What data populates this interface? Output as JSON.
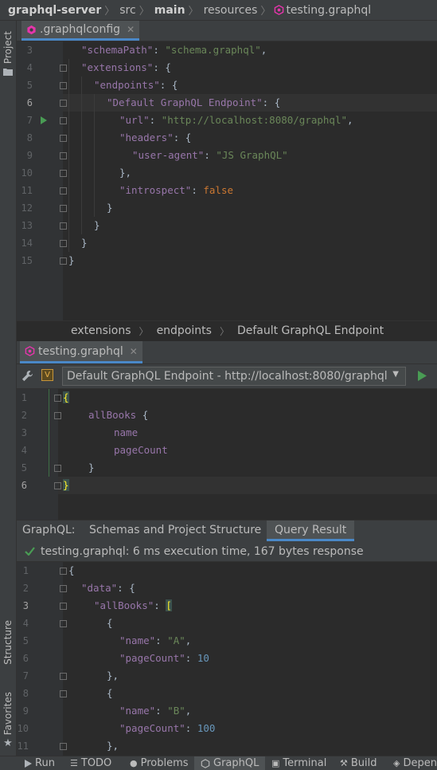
{
  "breadcrumb": {
    "items": [
      "graphql-server",
      "src",
      "main",
      "resources",
      "testing.graphql"
    ]
  },
  "left_strip": {
    "project": "Project",
    "structure": "Structure",
    "favorites": "Favorites"
  },
  "config_tab": {
    "label": ".graphqlconfig",
    "close": "✕"
  },
  "config_editor": {
    "lines": [
      {
        "num": "3",
        "parts": [
          [
            "k",
            "\"schemaPath\""
          ],
          [
            "p",
            ": "
          ],
          [
            "s",
            "\"schema.graphql\""
          ],
          [
            "p",
            ","
          ]
        ]
      },
      {
        "num": "4",
        "parts": [
          [
            "k",
            "\"extensions\""
          ],
          [
            "p",
            ": {"
          ]
        ]
      },
      {
        "num": "5",
        "parts": [
          [
            "k",
            "\"endpoints\""
          ],
          [
            "p",
            ": {"
          ]
        ]
      },
      {
        "num": "6",
        "parts": [
          [
            "k",
            "\"Default GraphQL Endpoint\""
          ],
          [
            "p",
            ": {"
          ]
        ]
      },
      {
        "num": "7",
        "parts": [
          [
            "k",
            "\"url\""
          ],
          [
            "p",
            ": "
          ],
          [
            "s",
            "\"http://localhost:8080/graphql\""
          ],
          [
            "p",
            ","
          ]
        ]
      },
      {
        "num": "8",
        "parts": [
          [
            "k",
            "\"headers\""
          ],
          [
            "p",
            ": {"
          ]
        ]
      },
      {
        "num": "9",
        "parts": [
          [
            "k",
            "\"user-agent\""
          ],
          [
            "p",
            ": "
          ],
          [
            "s",
            "\"JS GraphQL\""
          ]
        ]
      },
      {
        "num": "10",
        "parts": [
          [
            "p",
            "},"
          ]
        ]
      },
      {
        "num": "11",
        "parts": [
          [
            "k",
            "\"introspect\""
          ],
          [
            "p",
            ": "
          ],
          [
            "kw",
            "false"
          ]
        ]
      },
      {
        "num": "12",
        "parts": [
          [
            "p",
            "}"
          ]
        ]
      },
      {
        "num": "13",
        "parts": [
          [
            "p",
            "}"
          ]
        ]
      },
      {
        "num": "14",
        "parts": [
          [
            "p",
            "}"
          ]
        ]
      },
      {
        "num": "15",
        "parts": [
          [
            "p",
            "}"
          ]
        ]
      }
    ]
  },
  "config_breadcrumb": [
    "extensions",
    "endpoints",
    "Default GraphQL Endpoint"
  ],
  "query_tab": {
    "label": "testing.graphql",
    "close": "✕"
  },
  "endpoint": {
    "badge": "V",
    "selected": "Default GraphQL Endpoint - http://localhost:8080/graphql"
  },
  "query_editor": {
    "lines": [
      {
        "num": "1",
        "parts": [
          [
            "p",
            "{"
          ]
        ]
      },
      {
        "num": "2",
        "parts": [
          [
            "k",
            "allBooks"
          ],
          [
            "p",
            " {"
          ]
        ]
      },
      {
        "num": "3",
        "parts": [
          [
            "k",
            "name"
          ]
        ]
      },
      {
        "num": "4",
        "parts": [
          [
            "k",
            "pageCount"
          ]
        ]
      },
      {
        "num": "5",
        "parts": [
          [
            "p",
            "}"
          ]
        ]
      },
      {
        "num": "6",
        "parts": [
          [
            "p",
            "}"
          ]
        ]
      }
    ]
  },
  "result_tabs": {
    "prefix": "GraphQL:",
    "tab1": "Schemas and Project Structure",
    "tab2": "Query Result"
  },
  "status": {
    "text": "testing.graphql: 6 ms execution time, 167 bytes response"
  },
  "result_editor": {
    "lines": [
      {
        "num": "1",
        "parts": [
          [
            "p",
            "{"
          ]
        ]
      },
      {
        "num": "2",
        "parts": [
          [
            "k",
            "\"data\""
          ],
          [
            "p",
            ": {"
          ]
        ]
      },
      {
        "num": "3",
        "parts": [
          [
            "k",
            "\"allBooks\""
          ],
          [
            "p",
            ": "
          ],
          [
            "kw",
            "["
          ]
        ]
      },
      {
        "num": "4",
        "parts": [
          [
            "p",
            "{"
          ]
        ]
      },
      {
        "num": "5",
        "parts": [
          [
            "k",
            "\"name\""
          ],
          [
            "p",
            ": "
          ],
          [
            "s",
            "\"A\""
          ],
          [
            "p",
            ","
          ]
        ]
      },
      {
        "num": "6",
        "parts": [
          [
            "k",
            "\"pageCount\""
          ],
          [
            "p",
            ": "
          ],
          [
            "n",
            "10"
          ]
        ]
      },
      {
        "num": "7",
        "parts": [
          [
            "p",
            "},"
          ]
        ]
      },
      {
        "num": "8",
        "parts": [
          [
            "p",
            "{"
          ]
        ]
      },
      {
        "num": "9",
        "parts": [
          [
            "k",
            "\"name\""
          ],
          [
            "p",
            ": "
          ],
          [
            "s",
            "\"B\""
          ],
          [
            "p",
            ","
          ]
        ]
      },
      {
        "num": "10",
        "parts": [
          [
            "k",
            "\"pageCount\""
          ],
          [
            "p",
            ": "
          ],
          [
            "n",
            "100"
          ]
        ]
      },
      {
        "num": "11",
        "parts": [
          [
            "p",
            "},"
          ]
        ]
      }
    ]
  },
  "bottom_bar": {
    "run": "Run",
    "todo": "TODO",
    "problems": "Problems",
    "graphql": "GraphQL",
    "terminal": "Terminal",
    "build": "Build",
    "dependencies": "Depen"
  },
  "colors": {
    "accent": "#4a88c7",
    "key": "#9876aa",
    "string": "#6a8759",
    "keyword": "#cc7832",
    "number": "#6897bb",
    "run_green": "#499c54",
    "graphql_pink": "#e535ab"
  }
}
